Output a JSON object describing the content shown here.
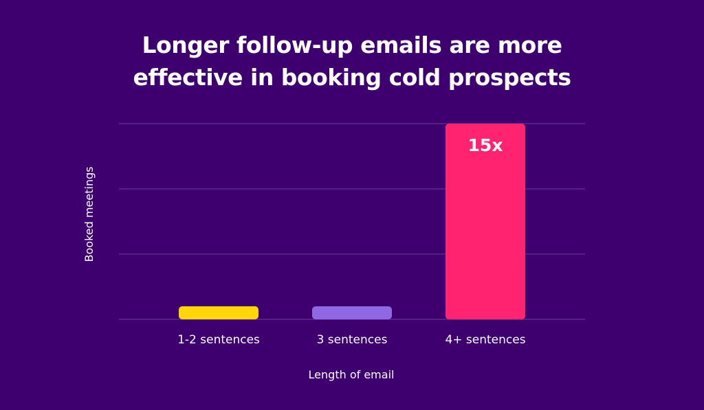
{
  "chart_data": {
    "type": "bar",
    "title_lines": [
      "Longer follow-up emails are more",
      "effective in booking cold prospects"
    ],
    "title": "Longer follow-up emails are more effective in booking cold prospects",
    "xlabel": "Length of email",
    "ylabel": "Booked meetings",
    "categories": [
      "1-2 sentences",
      "3 sentences",
      "4+ sentences"
    ],
    "values": [
      1,
      1,
      15
    ],
    "data_labels": [
      "",
      "",
      "15x"
    ],
    "colors": [
      "#ffd60a",
      "#9068e3",
      "#ff2370"
    ],
    "ylim": [
      0,
      15
    ],
    "gridlines": 4,
    "grid": true,
    "legend": "none"
  }
}
